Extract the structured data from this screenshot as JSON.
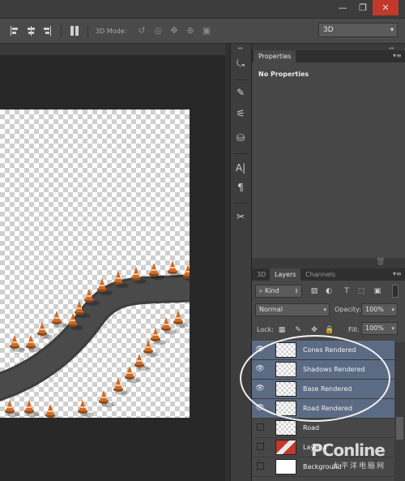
{
  "window": {
    "minimize_glyph": "—",
    "restore_glyph": "❐",
    "close_glyph": "✕"
  },
  "options_bar": {
    "mode_label": "3D Mode:",
    "mode_icons": [
      "rotate-3d-icon",
      "roll-3d-icon",
      "drag-3d-icon",
      "slide-3d-icon",
      "scale-3d-icon"
    ],
    "workspace_select": "3D"
  },
  "tools": [
    {
      "name": "history-icon",
      "glyph": "⤿"
    },
    {
      "name": "brush-icon",
      "glyph": "✎"
    },
    {
      "name": "adjustments-icon",
      "glyph": "⚟"
    },
    {
      "name": "stamp-icon",
      "glyph": "⛁"
    },
    {
      "name": "character-icon",
      "glyph": "A|"
    },
    {
      "name": "paragraph-icon",
      "glyph": "¶"
    },
    {
      "name": "tools-preset-icon",
      "glyph": "✂"
    }
  ],
  "properties_panel": {
    "tab": "Properties",
    "empty_message": "No Properties"
  },
  "layers_panel": {
    "tabs": [
      {
        "label": "3D",
        "active": false
      },
      {
        "label": "Layers",
        "active": true
      },
      {
        "label": "Channels",
        "active": false
      }
    ],
    "filter_kind": "Kind",
    "blend_mode": "Normal",
    "opacity_label": "Opacity:",
    "opacity_value": "100%",
    "lock_label": "Lock:",
    "fill_label": "Fill:",
    "fill_value": "100%",
    "layers": [
      {
        "name": "Cones Rendered",
        "visible": true,
        "selected": true
      },
      {
        "name": "Shadows Rendered",
        "visible": true,
        "selected": true
      },
      {
        "name": "Base Rendered",
        "visible": true,
        "selected": true
      },
      {
        "name": "Road Rendered",
        "visible": true,
        "selected": true
      },
      {
        "name": "Road",
        "visible": false,
        "selected": false
      },
      {
        "name": "Layer 1",
        "visible": false,
        "selected": false
      },
      {
        "name": "Background",
        "visible": false,
        "selected": false
      }
    ]
  },
  "watermark": {
    "text": "PConline",
    "sub": "太平洋电脑网"
  },
  "colors": {
    "selected_row": "#5b6b84",
    "panel_bg": "#474747",
    "app_bg": "#282828",
    "cone_orange": "#d2691e",
    "road": "#404040"
  }
}
